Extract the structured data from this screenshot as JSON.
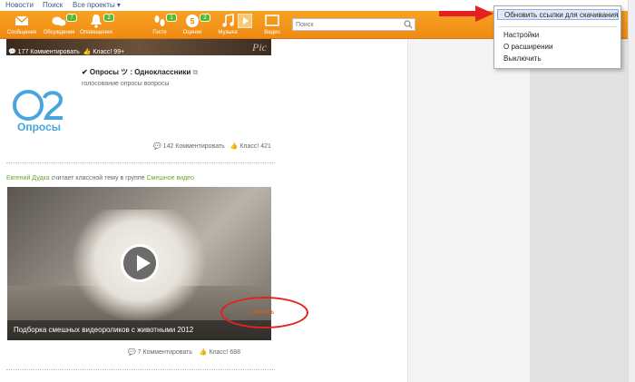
{
  "topnav": {
    "items": [
      "Новости",
      "Поиск",
      "Все проекты ▾"
    ]
  },
  "toolbar": {
    "items": [
      {
        "label": "Сообщения",
        "icon": "envelope-icon",
        "badge": ""
      },
      {
        "label": "Обсуждения",
        "icon": "chat-icon",
        "badge": "7"
      },
      {
        "label": "Оповещения",
        "icon": "bell-icon",
        "badge": "2"
      },
      {
        "label": "Гости",
        "icon": "footprints-icon",
        "badge": "1"
      },
      {
        "label": "Оценки",
        "icon": "rating-icon",
        "badge": "2"
      },
      {
        "label": "Музыка",
        "icon": "music-note-icon",
        "badge": ""
      },
      {
        "label": "",
        "icon": "play-square-icon",
        "badge": ""
      },
      {
        "label": "Видео",
        "icon": "video-icon",
        "badge": ""
      }
    ],
    "search_placeholder": "Поиск"
  },
  "feed": {
    "top_post": {
      "watermark": "Pic",
      "comments": "177 Комментировать",
      "likes": "Класс! 99+"
    },
    "poll_post": {
      "logo_text": "Опросы",
      "title": "✔ Опросы ツ : Одноклассники",
      "subtitle": "голосование опросы вопросы",
      "comments": "142 Комментировать",
      "likes": "Класс! 421"
    },
    "video_post": {
      "author": "Евгений Дудка",
      "action": " считает классной тему в группе ",
      "group": "Смешное видео",
      "caption": "Подборка смешных видеороликов с животными 2012",
      "comments": "7 Комментировать",
      "likes": "Класс! 688",
      "download": "Скачать"
    }
  },
  "menu": {
    "items": [
      "Обновить ссылки для скачивания",
      "Настройки",
      "О расширении",
      "Выключить"
    ]
  },
  "colors": {
    "toolbar": "#ef8a12",
    "badge": "#5bb82d",
    "link": "#6aa82a",
    "download": "#e05a1a",
    "annotation": "#e52020"
  }
}
